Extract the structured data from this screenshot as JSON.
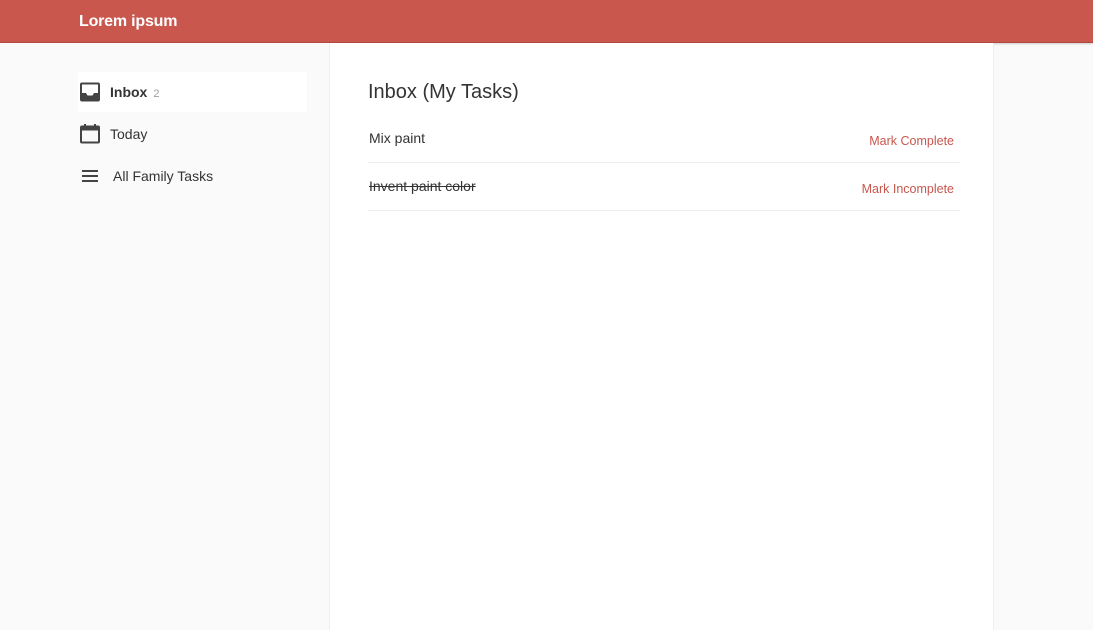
{
  "header": {
    "brand": "Lorem ipsum",
    "background_color": "#c9574d"
  },
  "sidebar": {
    "items": [
      {
        "label": "Inbox",
        "count": "2",
        "icon": "inbox-icon",
        "active": true
      },
      {
        "label": "Today",
        "icon": "calendar-icon",
        "active": false
      },
      {
        "label": "All Family Tasks",
        "icon": "list-icon",
        "active": false
      }
    ]
  },
  "main": {
    "title": "Inbox (My Tasks)",
    "tasks": [
      {
        "name": "Mix paint",
        "completed": false,
        "action": "Mark Complete"
      },
      {
        "name": "Invent paint color",
        "completed": true,
        "action": "Mark Incomplete"
      }
    ]
  },
  "colors": {
    "accent": "#c9574d",
    "text": "#333333",
    "muted": "#9e9e9e"
  }
}
